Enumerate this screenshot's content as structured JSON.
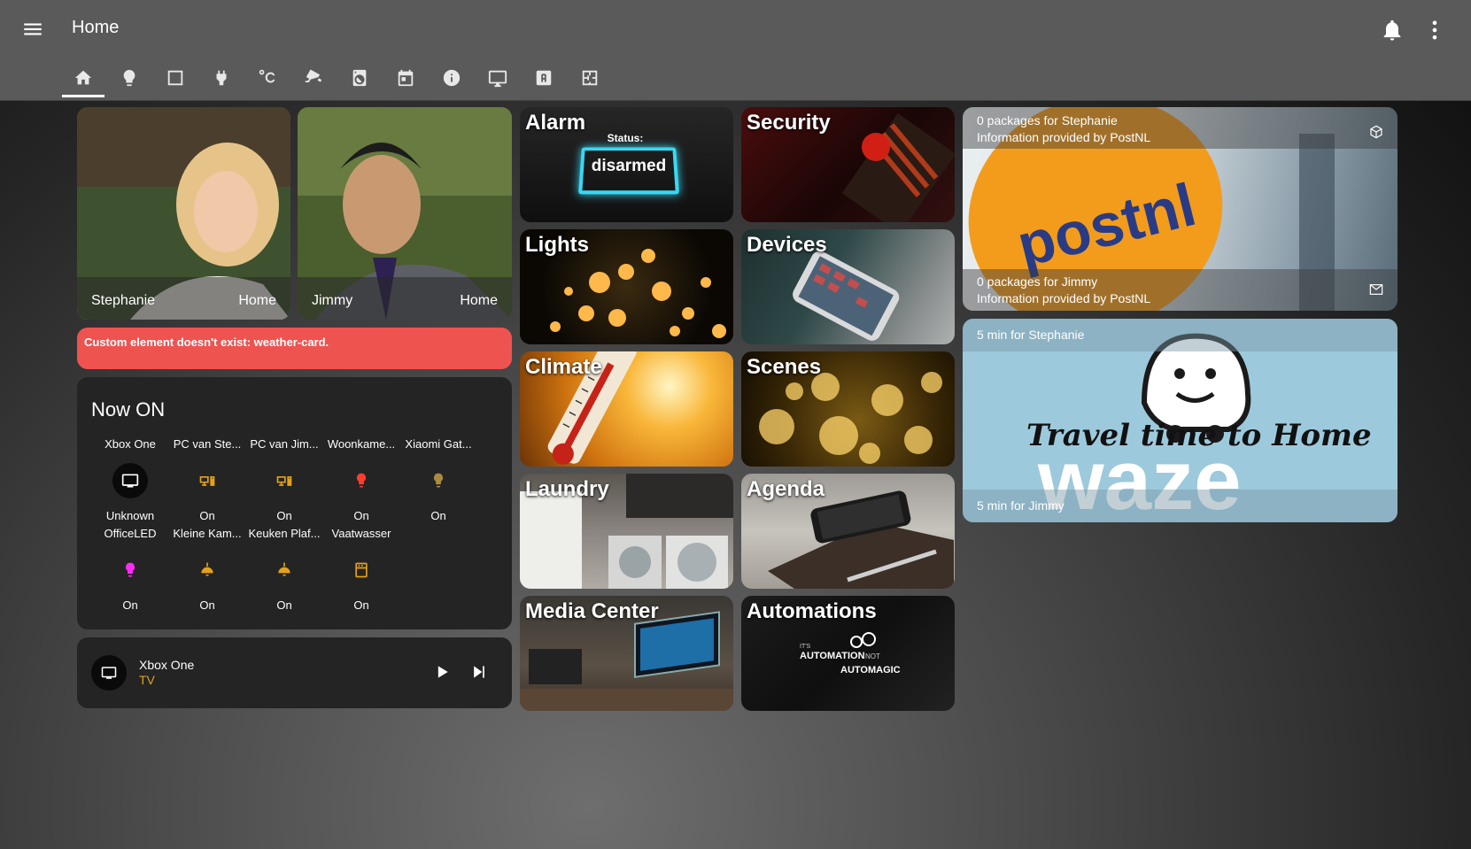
{
  "header": {
    "title": "Home",
    "icons": [
      "menu-icon",
      "notification-bell-icon",
      "more-vert-icon"
    ]
  },
  "tabs": [
    {
      "icon": "home-icon",
      "active": true
    },
    {
      "icon": "lightbulb-icon"
    },
    {
      "icon": "square-outline-icon"
    },
    {
      "icon": "power-plug-icon"
    },
    {
      "icon": "temperature-celsius-icon"
    },
    {
      "icon": "cctv-icon"
    },
    {
      "icon": "washing-machine-icon"
    },
    {
      "icon": "calendar-icon"
    },
    {
      "icon": "information-icon"
    },
    {
      "icon": "monitor-icon"
    },
    {
      "icon": "alpha-a-box-icon"
    },
    {
      "icon": "floor-plan-icon"
    }
  ],
  "people": [
    {
      "name": "Stephanie",
      "state": "Home"
    },
    {
      "name": "Jimmy",
      "state": "Home"
    }
  ],
  "error": {
    "message": "Custom element doesn't exist: weather-card."
  },
  "now_on": {
    "title": "Now ON",
    "entities": [
      {
        "name": "Xbox One",
        "state": "Unknown",
        "icon": "television-icon",
        "color": "#ffffff"
      },
      {
        "name": "PC van Ste...",
        "state": "On",
        "icon": "desktop-tower-monitor-icon",
        "color": "#e4a11b"
      },
      {
        "name": "PC van Jim...",
        "state": "On",
        "icon": "desktop-tower-monitor-icon",
        "color": "#e4a11b"
      },
      {
        "name": "Woonkame...",
        "state": "On",
        "icon": "lightbulb-icon",
        "color": "#ff3d2e"
      },
      {
        "name": "Xiaomi Gat...",
        "state": "On",
        "icon": "lightbulb-icon",
        "color": "#a98b3f"
      },
      {
        "name": "OfficeLED",
        "state": "On",
        "icon": "lightbulb-icon",
        "color": "#ff2bf5"
      },
      {
        "name": "Kleine Kam...",
        "state": "On",
        "icon": "ceiling-light-icon",
        "color": "#e4a11b"
      },
      {
        "name": "Keuken Plaf...",
        "state": "On",
        "icon": "ceiling-light-icon",
        "color": "#e4a11b"
      },
      {
        "name": "Vaatwasser",
        "state": "On",
        "icon": "dishwasher-icon",
        "color": "#e4a11b"
      }
    ]
  },
  "media_player": {
    "name": "Xbox One",
    "source": "TV"
  },
  "tiles": [
    {
      "label": "Alarm",
      "status_label": "Status:",
      "status": "disarmed"
    },
    {
      "label": "Security"
    },
    {
      "label": "Lights"
    },
    {
      "label": "Devices"
    },
    {
      "label": "Climate"
    },
    {
      "label": "Scenes"
    },
    {
      "label": "Laundry"
    },
    {
      "label": "Agenda"
    },
    {
      "label": "Media Center"
    },
    {
      "label": "Automations",
      "caption_top": "IT'S",
      "caption_main": "AUTOMATION",
      "caption_not": "NOT",
      "caption_end": "AUTOMAGIC"
    }
  ],
  "postnl": {
    "line1a": "0 packages for Stephanie",
    "line1b": "Information provided by PostNL",
    "line2a": "0 packages for Jimmy",
    "line2b": "Information provided by PostNL",
    "logo_text": "postnl"
  },
  "waze": {
    "top": "5 min for Stephanie",
    "bottom": "5 min for Jimmy",
    "headline": "Travel time to Home",
    "logo_text": "waze"
  }
}
